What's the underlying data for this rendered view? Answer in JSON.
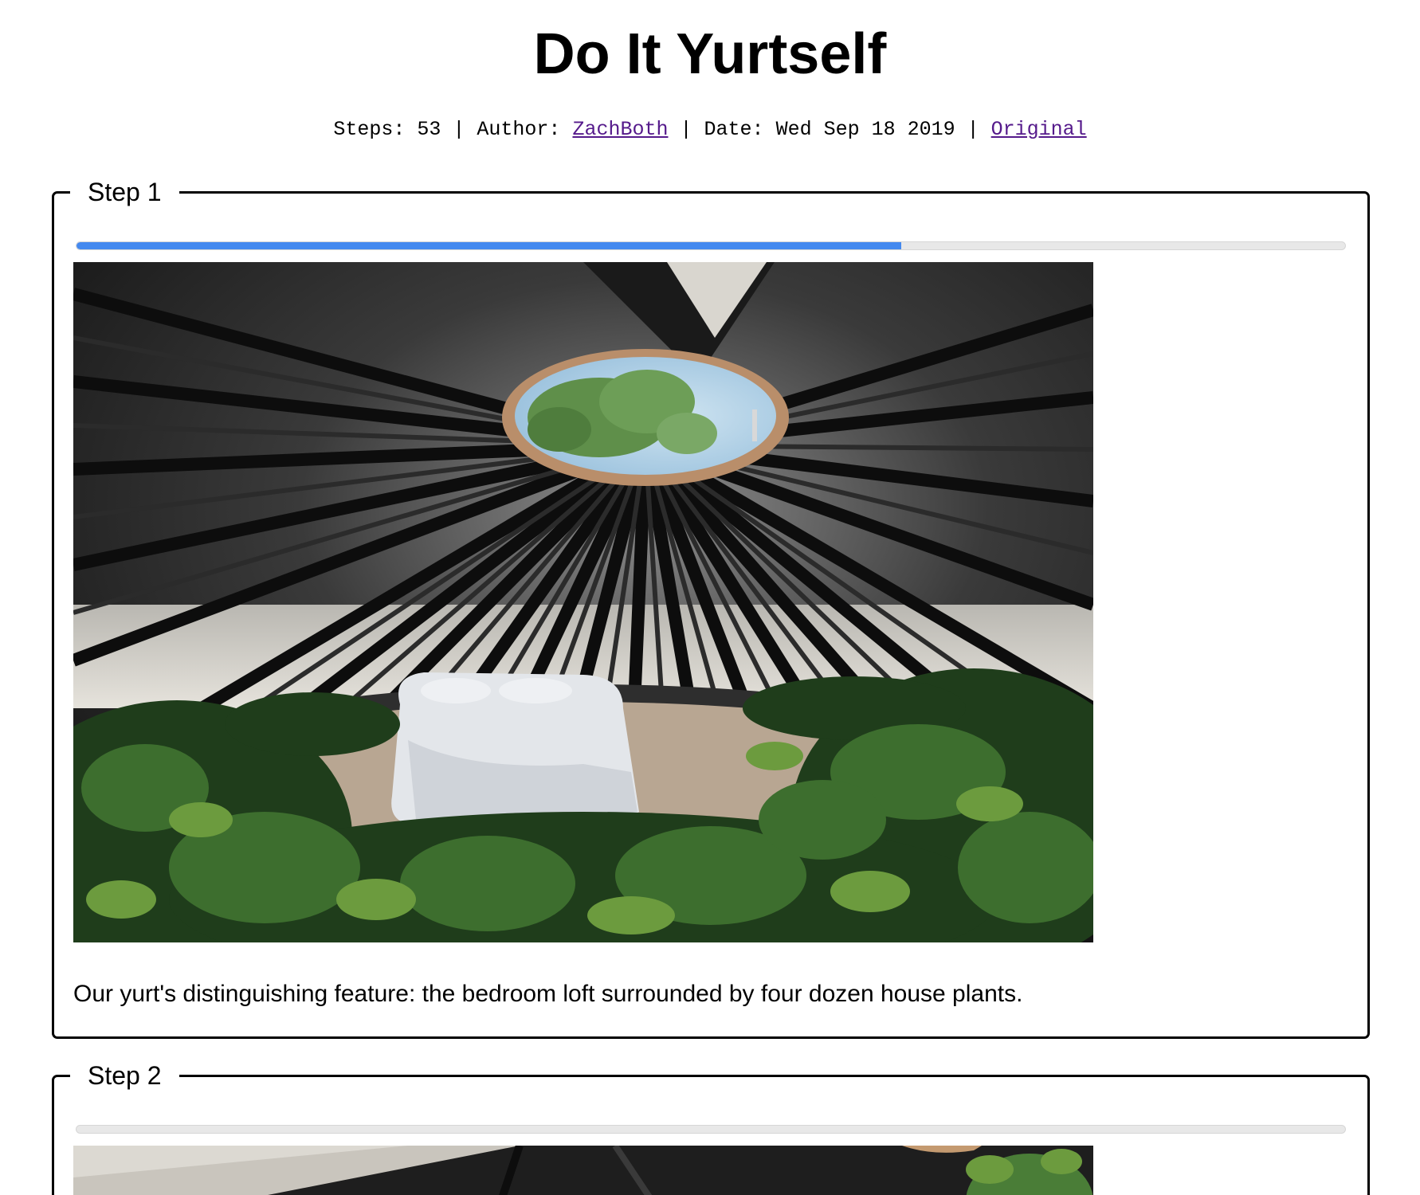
{
  "title": "Do It Yurtself",
  "meta": {
    "steps_label": "Steps:",
    "steps_value": "53",
    "sep": "|",
    "author_label": "Author:",
    "author_name": "ZachBoth",
    "date_label": "Date:",
    "date_value": "Wed Sep 18 2019",
    "original_link": "Original"
  },
  "steps": [
    {
      "legend": "Step 1",
      "progress": 0.65,
      "caption": "Our yurt's distinguishing feature: the bedroom loft surrounded by four dozen house plants."
    },
    {
      "legend": "Step 2",
      "progress": 0
    }
  ],
  "colors": {
    "progress_fill": "#4489ef",
    "progress_track": "#e8e8e8",
    "link_visited": "#551a8b"
  }
}
